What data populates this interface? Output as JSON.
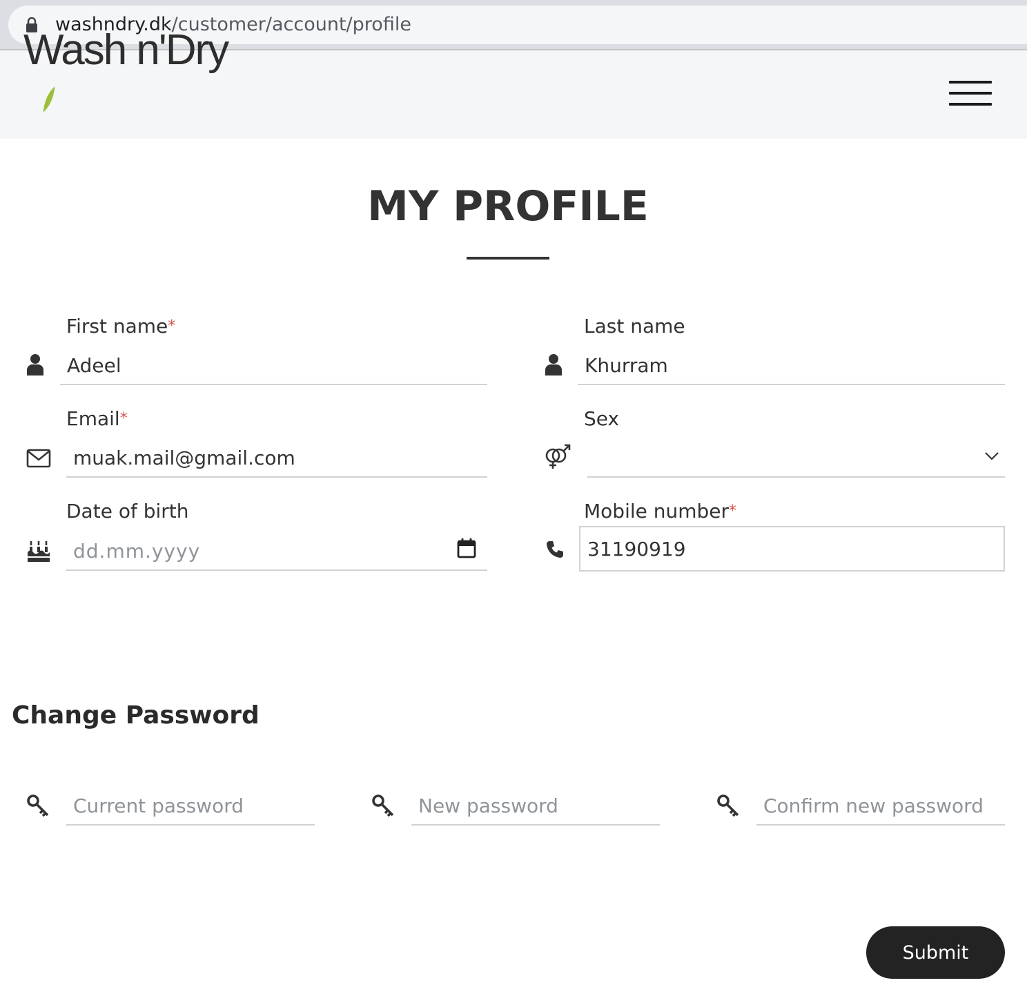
{
  "browser": {
    "url_domain": "washndry.dk",
    "url_path": "/customer/account/profile"
  },
  "header": {
    "logo_text": "Wash n'Dry"
  },
  "page": {
    "title": "MY PROFILE"
  },
  "profile": {
    "required_mark": "*",
    "first_name": {
      "label": "First name",
      "value": "Adeel"
    },
    "last_name": {
      "label": "Last name",
      "value": "Khurram"
    },
    "email": {
      "label": "Email",
      "value": "muak.mail@gmail.com"
    },
    "sex": {
      "label": "Sex",
      "value": ""
    },
    "dob": {
      "label": "Date of birth",
      "placeholder": "dd.mm.yyyy"
    },
    "mobile": {
      "label": "Mobile number",
      "value": "31190919"
    }
  },
  "password": {
    "title": "Change Password",
    "current_placeholder": "Current password",
    "new_placeholder": "New password",
    "confirm_placeholder": "Confirm new password"
  },
  "actions": {
    "submit_label": "Submit"
  },
  "colors": {
    "required": "#d9534f",
    "button": "#232323",
    "logo_leaf": "#9bbf3a"
  }
}
